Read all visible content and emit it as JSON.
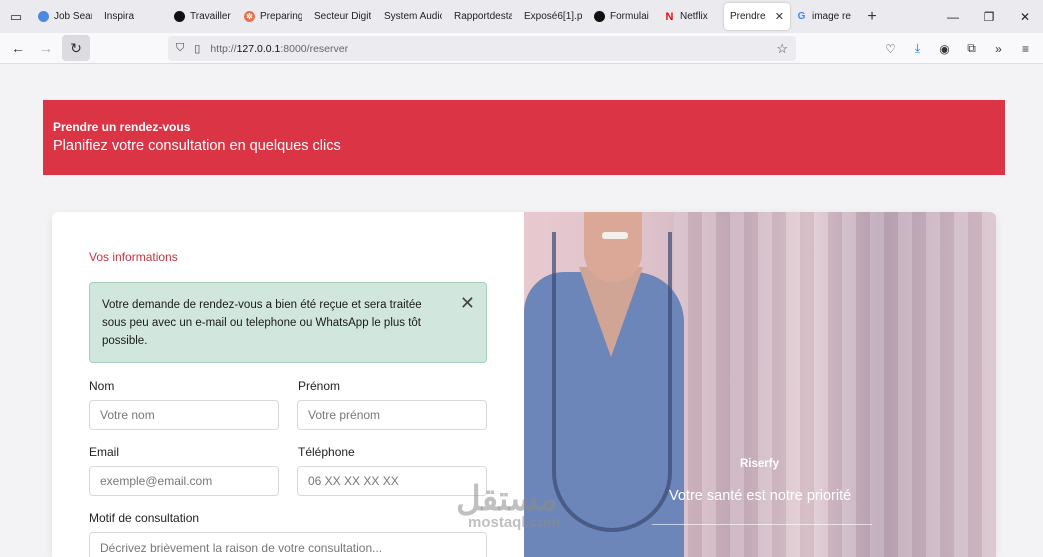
{
  "browser": {
    "tabs": [
      {
        "label": "Job Searc",
        "fav_color": "#4a8be0",
        "fav_glyph": ""
      },
      {
        "label": "Inspira",
        "fav_color": "",
        "fav_glyph": ""
      },
      {
        "label": "Travailler",
        "fav_color": "#111111",
        "fav_glyph": ""
      },
      {
        "label": "Preparing",
        "fav_color": "#e5734a",
        "fav_glyph": "✲"
      },
      {
        "label": "Secteur Digit",
        "fav_color": "",
        "fav_glyph": ""
      },
      {
        "label": "System Audio",
        "fav_color": "",
        "fav_glyph": ""
      },
      {
        "label": "Rapportdesta",
        "fav_color": "",
        "fav_glyph": ""
      },
      {
        "label": "Exposé6[1].p",
        "fav_color": "",
        "fav_glyph": ""
      },
      {
        "label": "Formulai",
        "fav_color": "#111111",
        "fav_glyph": ""
      },
      {
        "label": "Netflix",
        "fav_color": "#e50914",
        "fav_glyph": "N"
      },
      {
        "label": "Prendre un",
        "fav_color": "",
        "fav_glyph": "",
        "active": true
      },
      {
        "label": "image re",
        "fav_color": "#4285f4",
        "fav_glyph": "G"
      }
    ],
    "url_prefix": "http://",
    "url_host": "127.0.0.1",
    "url_rest": ":8000/reserver"
  },
  "hero": {
    "title": "Prendre un rendez-vous",
    "subtitle": "Planifiez votre consultation en quelques clics",
    "color": "#db3545"
  },
  "form": {
    "section_title": "Vos informations",
    "alert": "Votre demande de rendez-vous a bien été reçue et sera traitée sous peu avec un e-mail ou telephone ou WhatsApp le plus tôt possible.",
    "nom_label": "Nom",
    "nom_placeholder": "Votre nom",
    "prenom_label": "Prénom",
    "prenom_placeholder": "Votre prénom",
    "email_label": "Email",
    "email_placeholder": "exemple@email.com",
    "tel_label": "Téléphone",
    "tel_placeholder": "06 XX XX XX XX",
    "motif_label": "Motif de consultation",
    "motif_placeholder": "Décrivez brièvement la raison de votre consultation..."
  },
  "photo": {
    "brand": "Riserfy",
    "tagline": "Votre santé est notre priorité"
  },
  "watermark": {
    "arabic": "مستقل",
    "latin": "mostaql.com"
  }
}
